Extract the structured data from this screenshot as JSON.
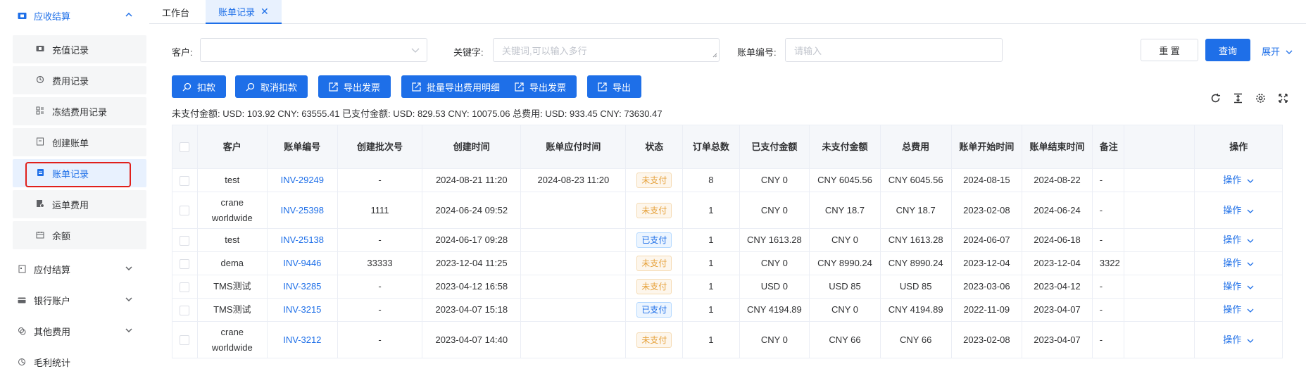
{
  "sidebar": {
    "groups": [
      {
        "label": "应收结算",
        "icon": "wallet-icon",
        "expanded": true
      },
      {
        "label": "应付结算",
        "icon": "payable-icon"
      },
      {
        "label": "银行账户",
        "icon": "bank-card-icon"
      },
      {
        "label": "其他费用",
        "icon": "coins-icon"
      },
      {
        "label": "毛利统计",
        "icon": "chart-icon"
      }
    ],
    "sub_items": [
      {
        "label": "充值记录",
        "icon": "recharge-icon"
      },
      {
        "label": "费用记录",
        "icon": "fee-record-icon"
      },
      {
        "label": "冻结费用记录",
        "icon": "frozen-icon"
      },
      {
        "label": "创建账单",
        "icon": "create-bill-icon"
      },
      {
        "label": "账单记录",
        "icon": "bill-record-icon",
        "selected": true
      },
      {
        "label": "运单费用",
        "icon": "waybill-icon"
      },
      {
        "label": "余额",
        "icon": "balance-icon"
      }
    ]
  },
  "tabs": [
    {
      "label": "工作台"
    },
    {
      "label": "账单记录",
      "active": true,
      "close": "✕"
    }
  ],
  "filters": {
    "customer_label": "客户:",
    "customer_value": "",
    "keyword_label": "关键字:",
    "keyword_placeholder": "关键词,可以输入多行",
    "bill_no_label": "账单编号:",
    "bill_no_placeholder": "请输入",
    "reset": "重 置",
    "search": "查询",
    "expand": "展开"
  },
  "actions": [
    "扣款",
    "取消扣款",
    "导出发票",
    "批量导出费用明细",
    "导出发票",
    "导出"
  ],
  "summary": "未支付金额: USD: 103.92 CNY: 63555.41  已支付金额: USD: 829.53 CNY: 10075.06  总费用: USD: 933.45 CNY: 73630.47",
  "table": {
    "headers": [
      "客户",
      "账单编号",
      "创建批次号",
      "创建时间",
      "账单应付时间",
      "状态",
      "订单总数",
      "已支付金额",
      "未支付金额",
      "总费用",
      "账单开始时间",
      "账单结束时间",
      "备注",
      "操作"
    ],
    "op_label": "操作",
    "rows": [
      {
        "customer": "test",
        "bill_no": "INV-29249",
        "batch": "-",
        "created": "2024-08-21 11:20",
        "due": "2024-08-23 11:20",
        "status": "未支付",
        "orders": "8",
        "paid": "CNY 0",
        "unpaid": "CNY 6045.56",
        "total": "CNY 6045.56",
        "start": "2024-08-15",
        "end": "2024-08-22",
        "remark": "-"
      },
      {
        "customer": "crane worldwide",
        "bill_no": "INV-25398",
        "batch": "1111",
        "created": "2024-06-24 09:52",
        "due": "",
        "status": "未支付",
        "orders": "1",
        "paid": "CNY 0",
        "unpaid": "CNY 18.7",
        "total": "CNY 18.7",
        "start": "2023-02-08",
        "end": "2024-06-24",
        "remark": "-"
      },
      {
        "customer": "test",
        "bill_no": "INV-25138",
        "batch": "-",
        "created": "2024-06-17 09:28",
        "due": "",
        "status": "已支付",
        "orders": "1",
        "paid": "CNY 1613.28",
        "unpaid": "CNY 0",
        "total": "CNY 1613.28",
        "start": "2024-06-07",
        "end": "2024-06-18",
        "remark": "-"
      },
      {
        "customer": "dema",
        "bill_no": "INV-9446",
        "batch": "33333",
        "created": "2023-12-04 11:25",
        "due": "",
        "status": "未支付",
        "orders": "1",
        "paid": "CNY 0",
        "unpaid": "CNY 8990.24",
        "total": "CNY 8990.24",
        "start": "2023-12-04",
        "end": "2023-12-04",
        "remark": "3322"
      },
      {
        "customer": "TMS测试",
        "bill_no": "INV-3285",
        "batch": "-",
        "created": "2023-04-12 16:58",
        "due": "",
        "status": "未支付",
        "orders": "1",
        "paid": "USD 0",
        "unpaid": "USD 85",
        "total": "USD 85",
        "start": "2023-03-06",
        "end": "2023-04-12",
        "remark": "-"
      },
      {
        "customer": "TMS测试",
        "bill_no": "INV-3215",
        "batch": "-",
        "created": "2023-04-07 15:18",
        "due": "",
        "status": "已支付",
        "orders": "1",
        "paid": "CNY 4194.89",
        "unpaid": "CNY 0",
        "total": "CNY 4194.89",
        "start": "2022-11-09",
        "end": "2023-04-07",
        "remark": "-"
      },
      {
        "customer": "crane worldwide",
        "bill_no": "INV-3212",
        "batch": "-",
        "created": "2023-04-07 14:40",
        "due": "",
        "status": "未支付",
        "orders": "1",
        "paid": "CNY 0",
        "unpaid": "CNY 66",
        "total": "CNY 66",
        "start": "2023-02-08",
        "end": "2023-04-07",
        "remark": "-"
      }
    ]
  },
  "colors": {
    "primary": "#1e6fe8",
    "unpaid": "#e6a23c",
    "highlight": "#e0201c"
  }
}
